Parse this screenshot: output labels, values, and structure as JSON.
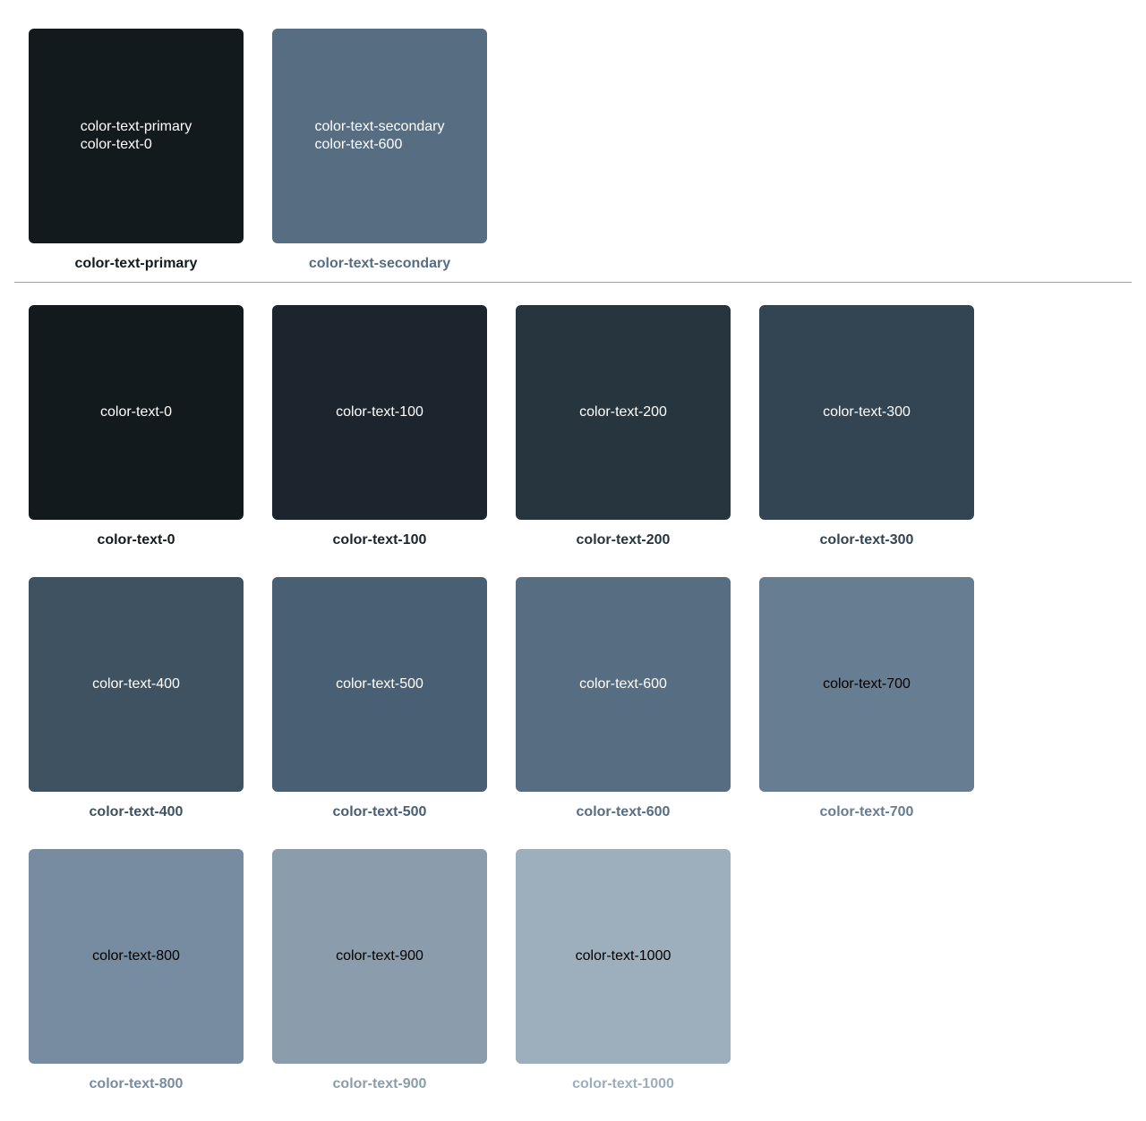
{
  "semantic": {
    "primary": {
      "caption": "color-text-primary",
      "line1": "color-text-primary",
      "line2": "color-text-0",
      "bg": "#131a1e",
      "fg": "#ffffff",
      "caption_color": "#131a1e"
    },
    "secondary": {
      "caption": "color-text-secondary",
      "line1": "color-text-secondary",
      "line2": "color-text-600",
      "bg": "#566d82",
      "fg": "#ffffff",
      "caption_color": "#566d82"
    }
  },
  "scale": [
    {
      "name": "color-text-0",
      "bg": "#131a1e",
      "fg": "#ffffff"
    },
    {
      "name": "color-text-100",
      "bg": "#1c252e",
      "fg": "#ffffff"
    },
    {
      "name": "color-text-200",
      "bg": "#27353f",
      "fg": "#ffffff"
    },
    {
      "name": "color-text-300",
      "bg": "#334453",
      "fg": "#ffffff"
    },
    {
      "name": "color-text-400",
      "bg": "#3e5262",
      "fg": "#ffffff"
    },
    {
      "name": "color-text-500",
      "bg": "#495f73",
      "fg": "#ffffff"
    },
    {
      "name": "color-text-600",
      "bg": "#566d82",
      "fg": "#ffffff"
    },
    {
      "name": "color-text-700",
      "bg": "#677d92",
      "fg": "#000000"
    },
    {
      "name": "color-text-800",
      "bg": "#778ca0",
      "fg": "#000000"
    },
    {
      "name": "color-text-900",
      "bg": "#8b9dac",
      "fg": "#000000"
    },
    {
      "name": "color-text-1000",
      "bg": "#9daebc",
      "fg": "#000000"
    }
  ]
}
